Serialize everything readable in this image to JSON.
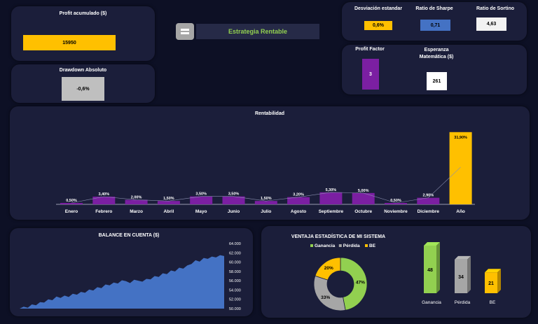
{
  "profit": {
    "title": "Profit acumulado ($)",
    "value": "15950",
    "color": "#ffc000"
  },
  "drawdown": {
    "title": "Drawdown Absoluto",
    "value": "-0,6%",
    "color": "#bfbfbf"
  },
  "strategy": {
    "label": "Estrategia Rentable",
    "icon": "equals-icon",
    "color": "#92d050"
  },
  "ratios": [
    {
      "title": "Desviación estandar",
      "value": "0,6%",
      "color": "#ffc000"
    },
    {
      "title": "Ratio de Sharpe",
      "value": "0,71",
      "color": "#4472c4"
    },
    {
      "title": "Ratio de Sortino",
      "value": "4,63",
      "color": "#f2f2f2"
    }
  ],
  "profit_factor": {
    "title": "Profit Factor",
    "value": "3",
    "color": "#7b1fa2"
  },
  "esperanza": {
    "title": "Esperanza Matemática ($)",
    "value": "261",
    "color": "#ffffff"
  },
  "rentabilidad": {
    "title": "Rentabilidad"
  },
  "balance": {
    "title": "BALANCE EN CUENTA ($)"
  },
  "ventaja": {
    "title": "VENTAJA ESTADÍSTICA DE MI SISTEMA"
  },
  "chart_data": [
    {
      "type": "bar",
      "title": "Rentabilidad",
      "categories": [
        "Enero",
        "Febrero",
        "Marzo",
        "Abril",
        "Mayo",
        "Junio",
        "Julio",
        "Agosto",
        "Septiembre",
        "Octubre",
        "Noviembre",
        "Diciembre",
        "Año"
      ],
      "values": [
        0.5,
        3.4,
        2.0,
        1.5,
        3.5,
        3.5,
        1.5,
        3.2,
        5.3,
        5.0,
        0.5,
        2.9,
        31.9
      ],
      "labels": [
        "0,50%",
        "3,40%",
        "2,00%",
        "1,50%",
        "3,50%",
        "3,50%",
        "1,50%",
        "3,20%",
        "5,30%",
        "5,00%",
        "0,50%",
        "2,90%",
        "31,90%"
      ],
      "colors": {
        "month": "#7b1fa2",
        "year": "#ffc000"
      },
      "ylim": [
        0,
        34
      ]
    },
    {
      "type": "area",
      "title": "BALANCE EN CUENTA ($)",
      "x": [
        0,
        2,
        4,
        6,
        8,
        10,
        12,
        14,
        16,
        18,
        20,
        22,
        24,
        26,
        28,
        30,
        32,
        34,
        36,
        38,
        40,
        42,
        44,
        46,
        48,
        50,
        52,
        54,
        56,
        58,
        60,
        62,
        64,
        66,
        68,
        70,
        72,
        74,
        76,
        78,
        80,
        82,
        84,
        86,
        88,
        90,
        92,
        94,
        96,
        98,
        100
      ],
      "values": [
        50000,
        50400,
        50200,
        50900,
        50700,
        51400,
        51300,
        52000,
        51800,
        52600,
        52300,
        52800,
        52500,
        53200,
        53000,
        53600,
        53400,
        54100,
        53900,
        54600,
        54400,
        55200,
        55000,
        55600,
        55400,
        56100,
        55900,
        55500,
        56200,
        56000,
        55800,
        56400,
        56300,
        57000,
        56800,
        57600,
        57400,
        58200,
        58000,
        58800,
        58600,
        59300,
        59600,
        60400,
        60100,
        60900,
        60700,
        61200,
        61000,
        61500,
        61300
      ],
      "yticks": [
        "50.000",
        "52.000",
        "54.000",
        "56.000",
        "58.000",
        "60.000",
        "62.000",
        "64.000"
      ],
      "ylim": [
        50000,
        64000
      ],
      "color": "#4472c4"
    },
    {
      "type": "pie",
      "title": "VENTAJA ESTADÍSTICA DE MI SISTEMA",
      "series": [
        {
          "name": "Ganancia",
          "value": 47,
          "label": "47%",
          "color": "#92d050"
        },
        {
          "name": "Pérdida",
          "value": 33,
          "label": "33%",
          "color": "#a6a6a6"
        },
        {
          "name": "BE",
          "value": 20,
          "label": "20%",
          "color": "#ffc000"
        }
      ]
    },
    {
      "type": "bar",
      "categories": [
        "Ganancia",
        "Pérdida",
        "BE"
      ],
      "values": [
        48,
        34,
        21
      ],
      "colors": [
        "#92d050",
        "#a6a6a6",
        "#ffc000"
      ],
      "ylim": [
        0,
        48
      ]
    }
  ]
}
